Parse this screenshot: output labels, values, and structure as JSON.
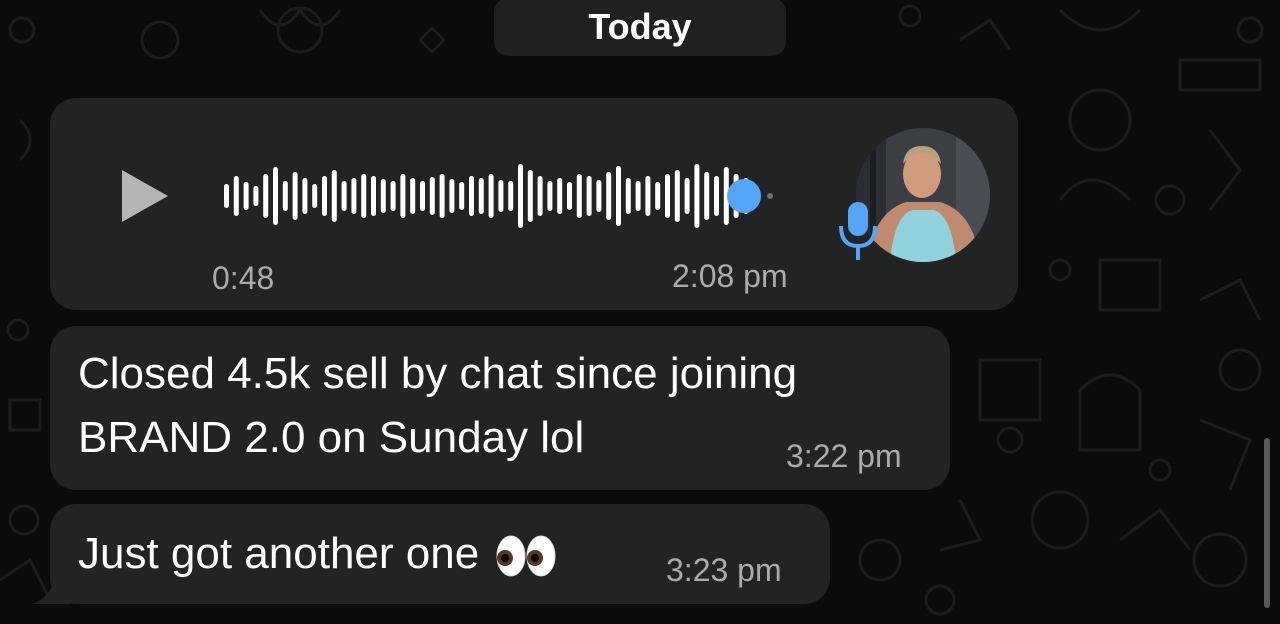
{
  "date_separator": {
    "label": "Today"
  },
  "voice_message": {
    "duration": "0:48",
    "time": "2:08 pm",
    "progress": 0.93,
    "accent_color": "#53a6f7",
    "play_icon": "play-icon",
    "mic_icon": "microphone-icon"
  },
  "messages": [
    {
      "lines": [
        "Closed 4.5k sell by chat since joining",
        "BRAND 2.0 on Sunday lol"
      ],
      "time": "3:22 pm"
    },
    {
      "text": "Just got another one",
      "emoji_icon": "eyes-emoji-icon",
      "time": "3:23 pm"
    }
  ],
  "colors": {
    "background": "#0b0b0b",
    "bubble": "#222424",
    "timestamp": "#a9acac",
    "accent": "#53a6f7"
  }
}
